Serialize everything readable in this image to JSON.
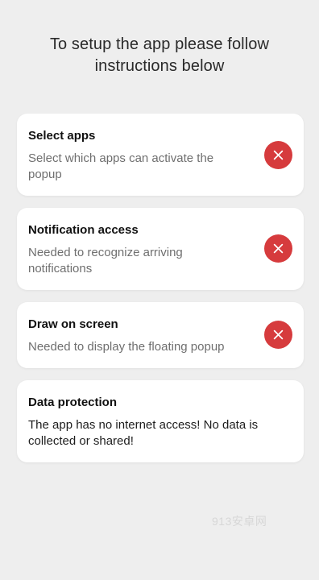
{
  "header": {
    "line1": "To setup the app please follow",
    "line2": "instructions below"
  },
  "colors": {
    "background": "#eeeeee",
    "card": "#ffffff",
    "error_status": "#d63b3d"
  },
  "cards": [
    {
      "title": "Select apps",
      "description": "Select which apps can activate the popup",
      "status_icon": "close-icon",
      "status": "not-granted"
    },
    {
      "title": "Notification access",
      "description": "Needed to recognize arriving notifications",
      "status_icon": "close-icon",
      "status": "not-granted"
    },
    {
      "title": "Draw on screen",
      "description": "Needed to display the floating popup",
      "status_icon": "close-icon",
      "status": "not-granted"
    },
    {
      "title": "Data protection",
      "description": "The app has no internet access! No data is collected or shared!"
    }
  ],
  "watermark": "913安卓网"
}
